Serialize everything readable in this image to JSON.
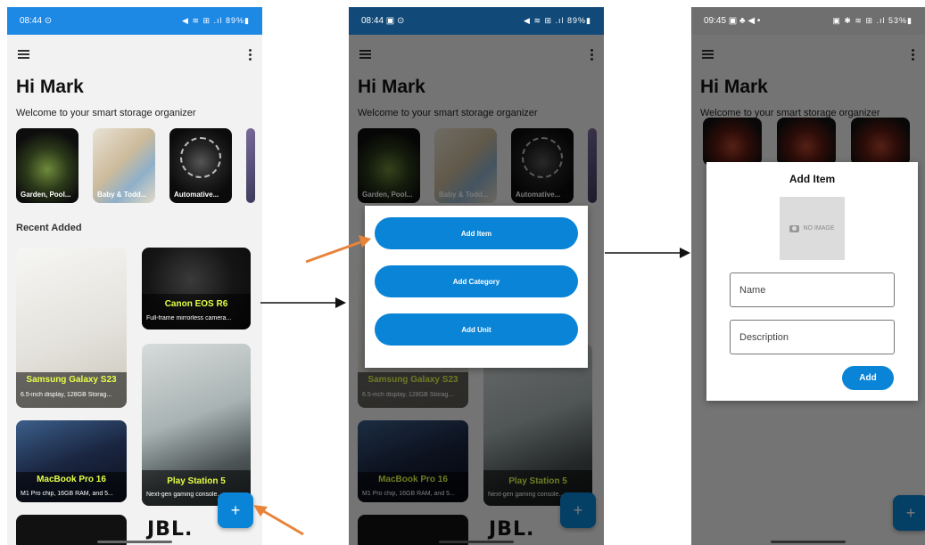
{
  "screens": {
    "home": {
      "status": {
        "time": "08:44 ⊙",
        "icons": "◀ ≋ ⊞ .ıl 89%▮"
      },
      "greeting": "Hi Mark",
      "welcome": "Welcome to your smart storage organizer",
      "categories": [
        "Garden, Pool...",
        "Baby & Todd...",
        "Automative..."
      ],
      "section_title": "Recent Added",
      "items": [
        {
          "title": "Samsung Galaxy S23",
          "desc": "6.5-inch display, 128GB Storag..."
        },
        {
          "title": "Canon EOS R6",
          "desc": "Full-frame mirrorless camera..."
        },
        {
          "title": "MacBook Pro 16",
          "desc": "M1 Pro chip, 16GB RAM, and 5..."
        },
        {
          "title": "Play Station 5",
          "desc": "Next-gen gaming console..."
        }
      ],
      "partial_brand": "JBL.",
      "fab": "+"
    },
    "menu": {
      "status": {
        "time": "08:44 ▣ ⊙",
        "icons": "◀ ≋ ⊞ .ıl 89%▮"
      },
      "buttons": [
        "Add Item",
        "Add Category",
        "Add Unit"
      ]
    },
    "add_item": {
      "status": {
        "time": "09:45 ▣ ♣ ◀ •",
        "icons": "▣ ✱ ≋ ⊞ .ıl 53%▮"
      },
      "title": "Add Item",
      "no_image": "NO IMAGE",
      "name_placeholder": "Name",
      "description_placeholder": "Description",
      "add_label": "Add"
    }
  },
  "colors": {
    "primary": "#0a84d6",
    "statusbar": "#1e88e5",
    "highlight": "#e6ff47",
    "arrow": "#e8833a"
  }
}
